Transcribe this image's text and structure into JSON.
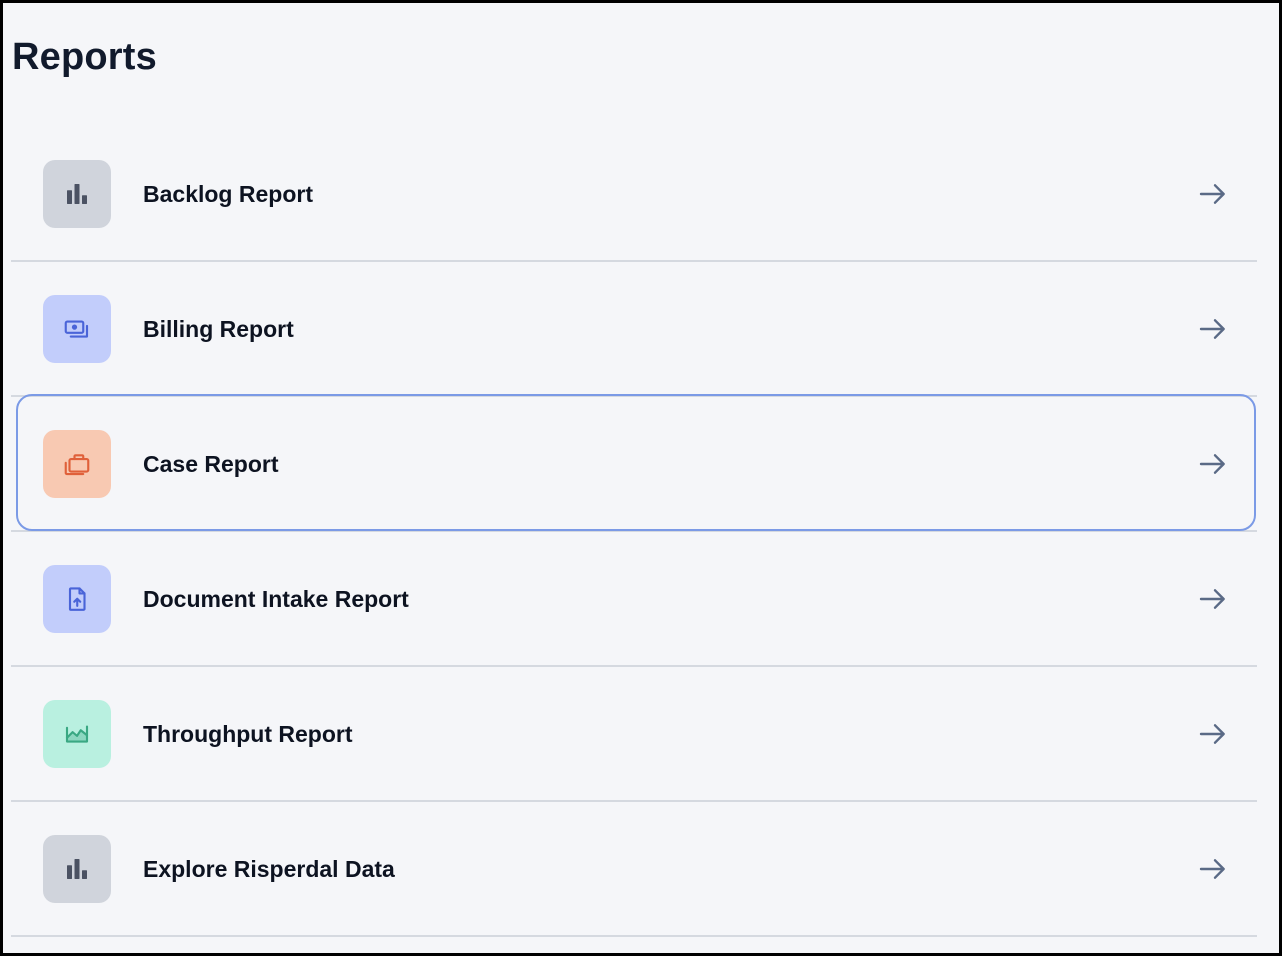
{
  "page": {
    "title": "Reports"
  },
  "colors": {
    "title": "#111a2c",
    "label": "#0d1321",
    "divider": "#d5d9e0",
    "selected_outline": "#7b9ae6",
    "arrow": "#5a6a86"
  },
  "reports": [
    {
      "label": "Backlog Report",
      "icon": "bar-chart-icon",
      "tile_color": "#d0d4dc",
      "icon_color": "#4b5263",
      "selected": false
    },
    {
      "label": "Billing Report",
      "icon": "money-bill-icon",
      "tile_color": "#c2cdfb",
      "icon_color": "#4a64d8",
      "selected": false
    },
    {
      "label": "Case Report",
      "icon": "briefcase-icon",
      "tile_color": "#f8c9b2",
      "icon_color": "#e0603a",
      "selected": true
    },
    {
      "label": "Document Intake Report",
      "icon": "document-upload-icon",
      "tile_color": "#c2cdfb",
      "icon_color": "#4a64d8",
      "selected": false
    },
    {
      "label": "Throughput Report",
      "icon": "area-chart-icon",
      "tile_color": "#b9f0e0",
      "icon_color": "#3aa883",
      "selected": false
    },
    {
      "label": "Explore Risperdal Data",
      "icon": "bar-chart-icon",
      "tile_color": "#d0d4dc",
      "icon_color": "#4b5263",
      "selected": false
    }
  ]
}
